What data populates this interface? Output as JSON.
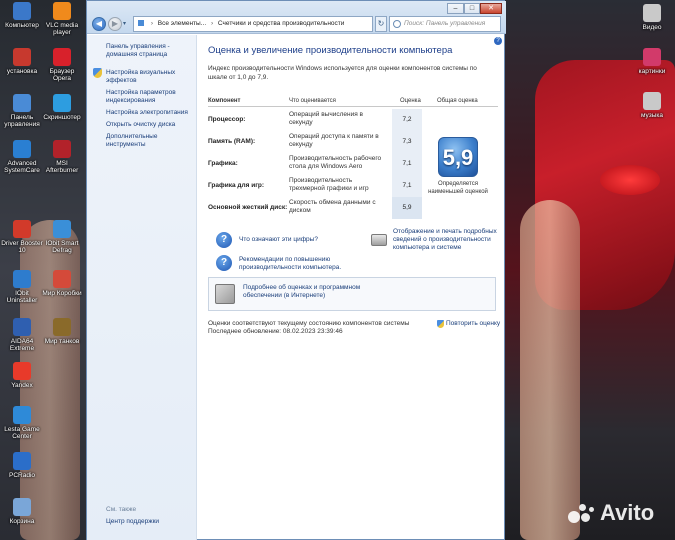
{
  "desktop": {
    "icons_left": [
      {
        "label": "Компьютер",
        "color": "#3b78c9"
      },
      {
        "label": "VLC media player",
        "color": "#f08a1c"
      },
      {
        "label": "установка",
        "color": "#c7392e"
      },
      {
        "label": "Браузер Opera",
        "color": "#d8212b"
      },
      {
        "label": "Панель управления",
        "color": "#4a8bd6"
      },
      {
        "label": "Скриншотер",
        "color": "#2d9de0"
      },
      {
        "label": "Advanced SystemCare",
        "color": "#2a7fd2"
      },
      {
        "label": "MSI Afterburner",
        "color": "#b2222a"
      },
      {
        "label": "Driver Booster 10",
        "color": "#d23a2a"
      },
      {
        "label": "IObit Smart Defrag",
        "color": "#3a8fd8"
      },
      {
        "label": "IObit Uninstaller",
        "color": "#2e7ccd"
      },
      {
        "label": "Мир Коробки",
        "color": "#d44a3a"
      },
      {
        "label": "AIDA64 Extreme",
        "color": "#2f5fb0"
      },
      {
        "label": "Мир танков",
        "color": "#8a6a2a"
      },
      {
        "label": "Yandex",
        "color": "#e83a2a"
      },
      {
        "label": "Lesta Game Center",
        "color": "#2e8ad8"
      },
      {
        "label": "PCRadio",
        "color": "#2b6ec9"
      },
      {
        "label": "Корзина",
        "color": "#7aa6d8"
      }
    ],
    "icons_right": [
      {
        "label": "Видео",
        "color": "#c9c9c9"
      },
      {
        "label": "картинки",
        "color": "#d23a6a"
      },
      {
        "label": "музыка",
        "color": "#c9c9c9"
      }
    ],
    "watermark": "Avito"
  },
  "window": {
    "breadcrumb": [
      "Все элементы...",
      "Счетчики и средства производительности"
    ],
    "search_placeholder": "Поиск: Панель управления",
    "caption_buttons": {
      "minimize": "–",
      "maximize": "□",
      "close": "✕"
    },
    "refresh_glyph": "↻",
    "help_glyph": "?"
  },
  "leftpane": {
    "home_link": "Панель управления - домашняя страница",
    "links": [
      "Настройка визуальных эффектов",
      "Настройка параметров индексирования",
      "Настройка электропитания",
      "Открыть очистку диска",
      "Дополнительные инструменты"
    ],
    "see_also": "См. также",
    "support": "Центр поддержки"
  },
  "main": {
    "title": "Оценка и увеличение производительности компьютера",
    "description": "Индекс производительности Windows используется для оценки компонентов системы по шкале от 1,0 до 7,9.",
    "table_headers": {
      "component": "Компонент",
      "what": "Что оценивается",
      "score": "Оценка",
      "overall": "Общая оценка"
    },
    "rows": [
      {
        "component": "Процессор:",
        "what": "Операций вычисления в секунду",
        "score": "7,2"
      },
      {
        "component": "Память (RAM):",
        "what": "Операций доступа к памяти в секунду",
        "score": "7,3"
      },
      {
        "component": "Графика:",
        "what": "Производительность рабочего стола для Windows Aero",
        "score": "7,1"
      },
      {
        "component": "Графика для игр:",
        "what": "Производительность трехмерной графики и игр",
        "score": "7,1"
      },
      {
        "component": "Основной жесткий диск:",
        "what": "Скорость обмена данными с диском",
        "score": "5,9"
      }
    ],
    "overall_score": "5,9",
    "overall_caption": "Определяется наименьшей оценкой",
    "links": {
      "what_mean": "Что означают эти цифры?",
      "print_details": "Отображение и печать подробных сведений о производительности компьютера и системе",
      "recommendations": "Рекомендации по повышению производительности компьютера."
    },
    "details_link": "Подробнее об оценках и программном обеспечении (в Интернете)",
    "status_current": "Оценки соответствуют текущему состоянию компонентов системы",
    "last_update": "Последнее обновление: 08.02.2023 23:39:46",
    "rerun": "Повторить оценку"
  }
}
